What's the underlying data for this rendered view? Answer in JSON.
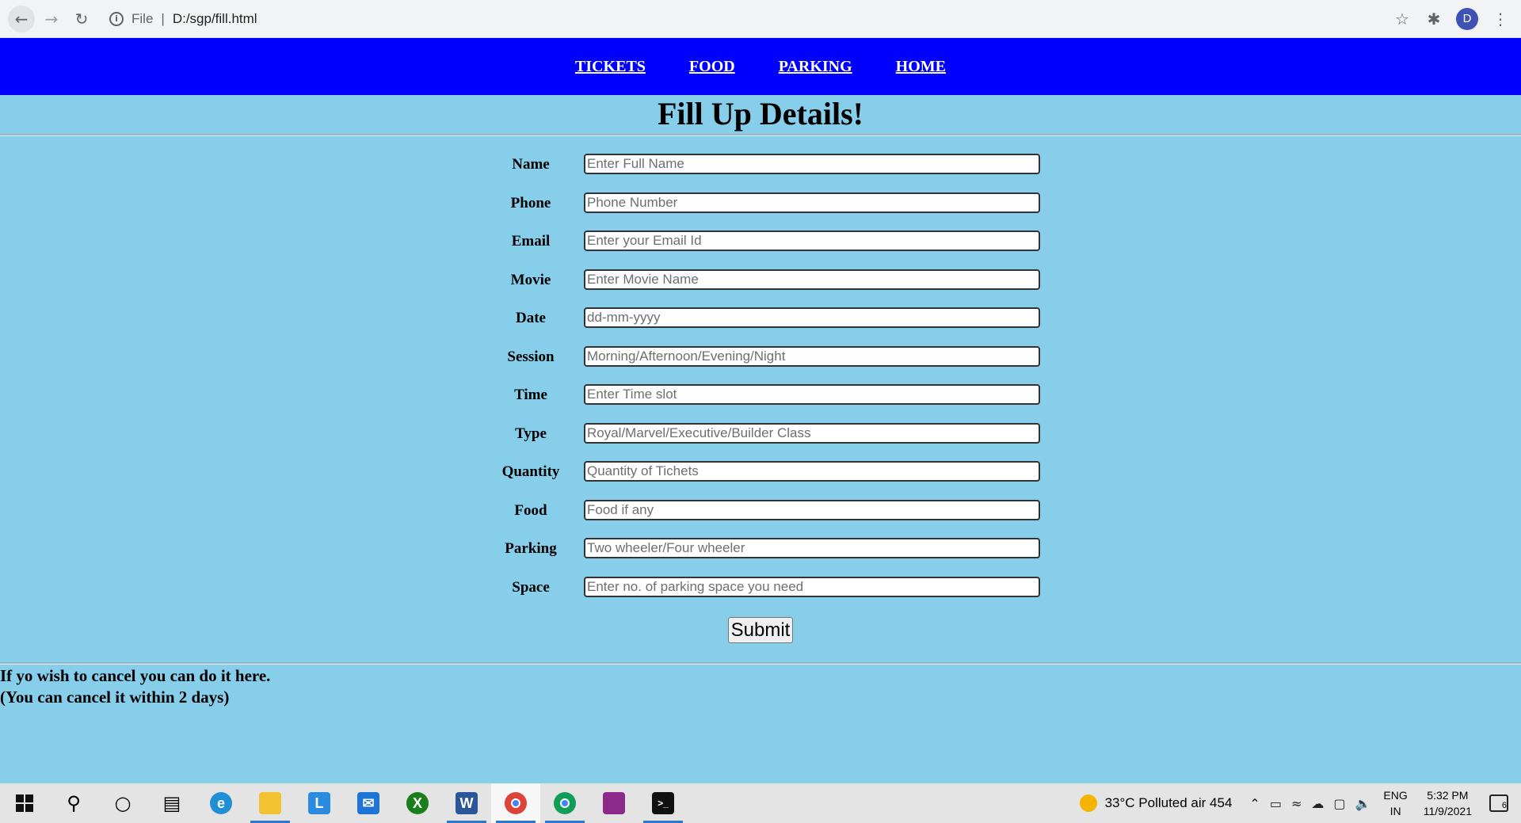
{
  "browser": {
    "scheme": "File",
    "url": "D:/sgp/fill.html",
    "profile_initial": "D",
    "icons": [
      "back-arrow-icon",
      "forward-arrow-icon",
      "reload-icon",
      "info-icon",
      "star-icon",
      "puzzle-icon",
      "kebab-menu-icon"
    ]
  },
  "nav": {
    "items": [
      {
        "label": "TICKETS"
      },
      {
        "label": "FOOD"
      },
      {
        "label": "PARKING"
      },
      {
        "label": "HOME"
      }
    ]
  },
  "page": {
    "title": "Fill Up Details!",
    "submit_label": "Submit",
    "cancel_line1": "If yo wish to cancel you can do it here.",
    "cancel_line2": "(You can cancel it within 2 days)"
  },
  "fields": [
    {
      "label": "Name",
      "placeholder": "Enter Full Name"
    },
    {
      "label": "Phone",
      "placeholder": "Phone Number"
    },
    {
      "label": "Email",
      "placeholder": "Enter your Email Id"
    },
    {
      "label": "Movie",
      "placeholder": "Enter Movie Name"
    },
    {
      "label": "Date",
      "placeholder": "dd-mm-yyyy"
    },
    {
      "label": "Session",
      "placeholder": "Morning/Afternoon/Evening/Night"
    },
    {
      "label": "Time",
      "placeholder": "Enter Time slot"
    },
    {
      "label": "Type",
      "placeholder": "Royal/Marvel/Executive/Builder Class"
    },
    {
      "label": "Quantity",
      "placeholder": "Quantity of Tichets"
    },
    {
      "label": "Food",
      "placeholder": "Food if any"
    },
    {
      "label": "Parking",
      "placeholder": "Two wheeler/Four wheeler"
    },
    {
      "label": "Space",
      "placeholder": "Enter no. of parking space you need"
    }
  ],
  "taskbar": {
    "weather": "33°C  Polluted air 454",
    "lang_top": "ENG",
    "lang_bottom": "IN",
    "time": "5:32 PM",
    "date": "11/9/2021",
    "notification_count": "6",
    "colors": {
      "accent": "#2f78c7"
    }
  },
  "colors": {
    "page_bg": "#87ceeb",
    "nav_bg": "#0000ff"
  }
}
